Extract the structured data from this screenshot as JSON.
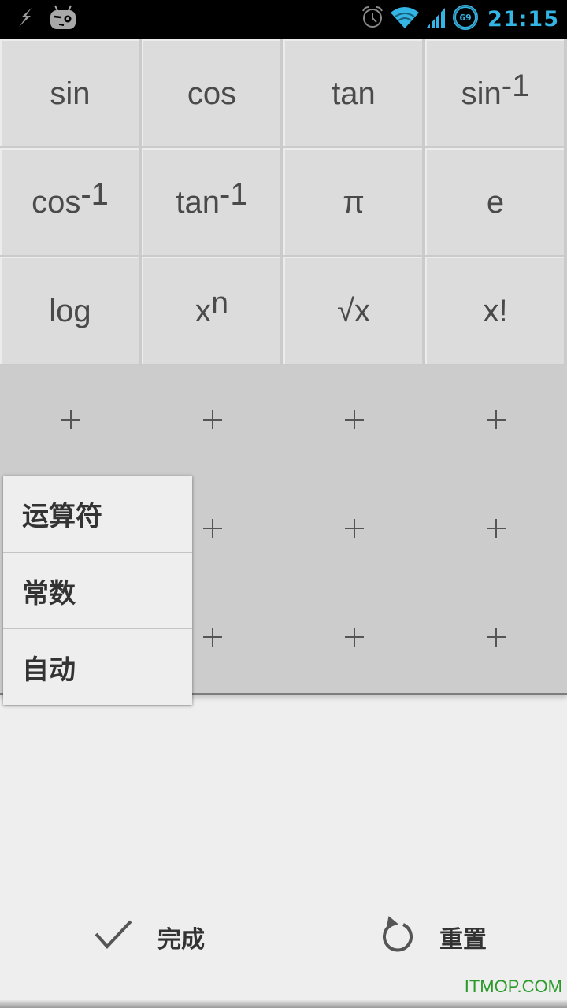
{
  "status_bar": {
    "left_icons": [
      "charging-bolt-icon",
      "cyanogenmod-mascot-icon"
    ],
    "right_icons": [
      "alarm-clock-icon",
      "wifi-icon",
      "cell-signal-icon",
      "battery-circle-icon"
    ],
    "battery_level": "69",
    "time": "21:15",
    "accent_color": "#33b5e5"
  },
  "function_keys": [
    {
      "label": "sin",
      "sup": ""
    },
    {
      "label": "cos",
      "sup": ""
    },
    {
      "label": "tan",
      "sup": ""
    },
    {
      "label": "sin",
      "sup": "-1"
    },
    {
      "label": "cos",
      "sup": "-1"
    },
    {
      "label": "tan",
      "sup": "-1"
    },
    {
      "label": "π",
      "sup": ""
    },
    {
      "label": "e",
      "sup": ""
    },
    {
      "label": "log",
      "sup": ""
    },
    {
      "label": "x",
      "sup": "n"
    },
    {
      "label": "√x",
      "sup": ""
    },
    {
      "label": "x!",
      "sup": ""
    }
  ],
  "slots": {
    "count": 12,
    "icon": "plus-icon"
  },
  "popup_menu": {
    "items": [
      "运算符",
      "常数",
      "自动"
    ]
  },
  "actions": {
    "done_label": "完成",
    "done_icon": "checkmark-icon",
    "reset_label": "重置",
    "reset_icon": "rotate-ccw-icon"
  },
  "watermark": "ITMOP.COM"
}
